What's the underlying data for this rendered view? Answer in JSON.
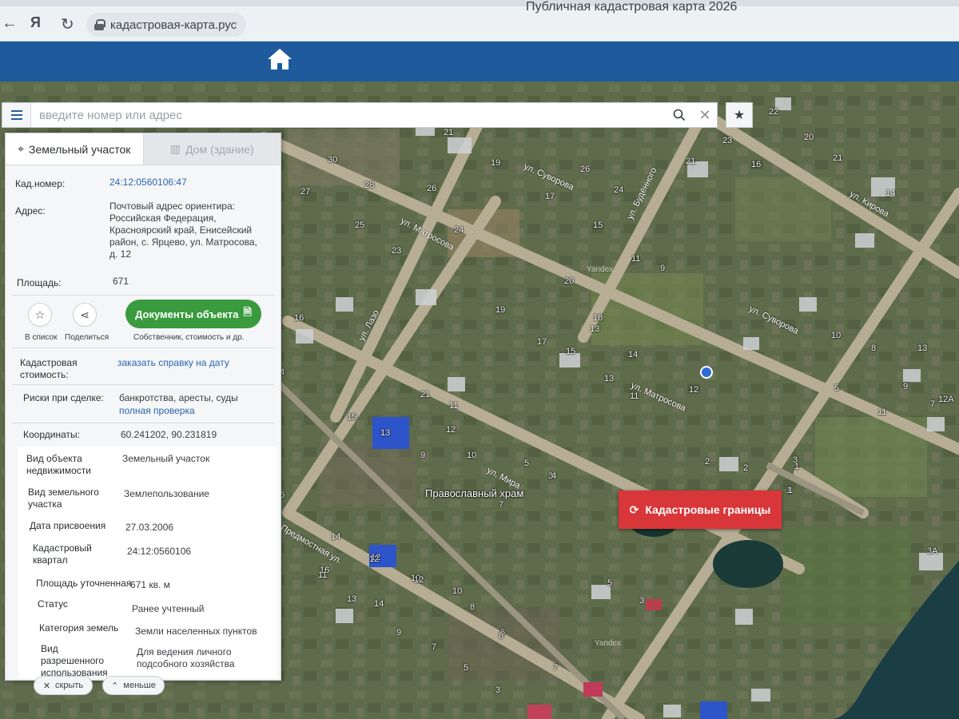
{
  "browser": {
    "url": "кадастровая-карта.рус",
    "window_title": "Публичная кадастровая карта 2026",
    "yandex_button": "Я"
  },
  "search": {
    "placeholder": "введите номер или адрес"
  },
  "tabs": [
    {
      "label": "Земельный участок",
      "active": true
    },
    {
      "label": "Дом (здание)",
      "active": false
    }
  ],
  "summary": {
    "cad_number_label": "Кад.номер:",
    "cad_number_value": "24:12:0560106:47",
    "address_label": "Адрес:",
    "address_value": "Почтовый адрес ориентира: Российская Федерация, Красноярский край, Енисейский район, с. Ярцево, ул. Матросова, д. 12",
    "area_label": "Площадь:",
    "area_value": "671"
  },
  "actions": {
    "add_to_list": "В список",
    "share": "Поделиться",
    "documents_button": "Документы объекта",
    "documents_sub": "Собственник, стоимость и др."
  },
  "cost": {
    "label": "Кадастровая стоимость:",
    "link": "заказать справку на дату"
  },
  "risks": {
    "label": "Риски при сделке:",
    "value": "банкротства, аресты, суды",
    "link": "полная проверка"
  },
  "coords": {
    "label": "Координаты:",
    "value": "60.241202, 90.231819"
  },
  "details": [
    {
      "label": "Вид объекта недвижимости",
      "value": "Земельный участок"
    },
    {
      "label": "Вид земельного участка",
      "value": "Землепользование"
    },
    {
      "label": "Дата присвоения",
      "value": "27.03.2006"
    },
    {
      "label": "Кадастровый квартал",
      "value": "24:12:0560106"
    },
    {
      "label": "Площадь уточненная",
      "value": "671 кв. м"
    },
    {
      "label": "Статус",
      "value": "Ранее учтенный"
    },
    {
      "label": "Категория земель",
      "value": "Земли населенных пунктов"
    },
    {
      "label": "Вид разрешенного использования",
      "value": "Для ведения личного подсобного хозяйства"
    }
  ],
  "bottom": {
    "hide": "скрыть",
    "less": "меньше"
  },
  "map": {
    "cadastral_button": "Кадастровые границы",
    "church": "Православный храм",
    "streets": [
      "ул. Матросова",
      "ул. Суворова",
      "ул. Кирова",
      "ул. Будённого",
      "ул. Мира",
      "ул. Лазо",
      "Предмостная ул."
    ],
    "watermark": "Yandex",
    "house_numbers": [
      "21",
      "30",
      "27",
      "28",
      "26",
      "19",
      "17",
      "26",
      "24",
      "21",
      "23",
      "22",
      "20",
      "21",
      "16",
      "14",
      "25",
      "24",
      "23",
      "15",
      "13",
      "11",
      "9",
      "20",
      "18",
      "14",
      "12",
      "10",
      "8",
      "16",
      "19",
      "17",
      "15",
      "13",
      "11",
      "16",
      "14",
      "12",
      "10",
      "8",
      "6",
      "4",
      "15",
      "13",
      "11",
      "12",
      "9",
      "10",
      "7",
      "5",
      "3",
      "2",
      "1",
      "16",
      "14",
      "12",
      "10",
      "8",
      "7",
      "5",
      "3",
      "3А",
      "13",
      "11",
      "9",
      "7",
      "5",
      "3",
      "1",
      "4",
      "2",
      "12",
      "13",
      "11",
      "9",
      "7",
      "5",
      "3",
      "1",
      "12А",
      "21"
    ]
  }
}
